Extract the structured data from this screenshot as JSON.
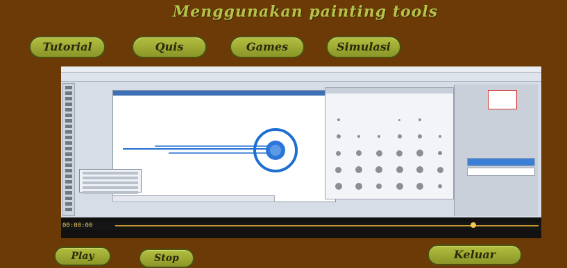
{
  "header": {
    "title": "Menggunakan painting tools"
  },
  "nav": [
    {
      "label": "Tutorial"
    },
    {
      "label": "Quis"
    },
    {
      "label": "Games"
    },
    {
      "label": "Simulasi"
    }
  ],
  "player": {
    "timecode": "00:00:00"
  },
  "controls": {
    "play": "Play",
    "stop": "Stop",
    "exit": "Keluar"
  },
  "colors": {
    "background": "#6b3a06",
    "button": "#a3ae36",
    "title": "#b4c24a",
    "brush_stroke": "#1f6fd1"
  }
}
